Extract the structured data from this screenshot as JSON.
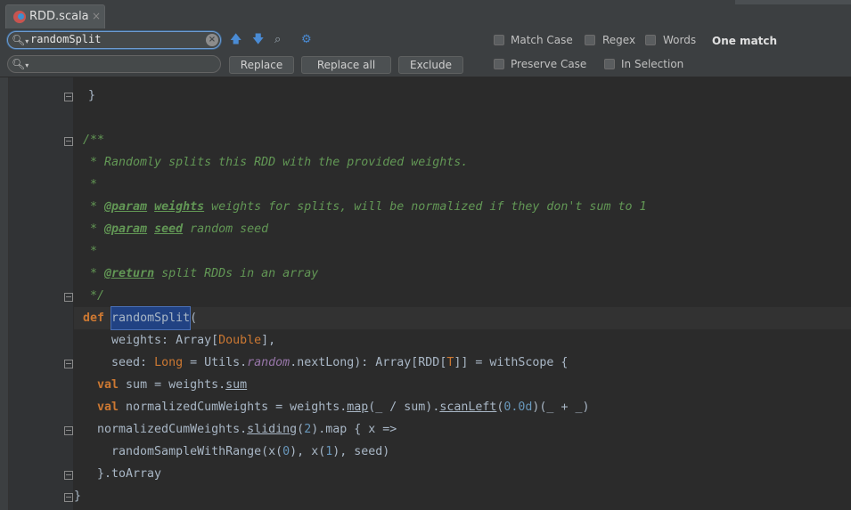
{
  "tab": {
    "label": "RDD.scala",
    "close": "×"
  },
  "find": {
    "query": "randomSplit",
    "replace_value": "",
    "buttons": {
      "replace": "Replace",
      "replace_all": "Replace all",
      "exclude": "Exclude"
    },
    "options": {
      "match_case": "Match Case",
      "regex": "Regex",
      "words": "Words",
      "preserve_case": "Preserve Case",
      "in_selection": "In Selection"
    },
    "result": "One match"
  },
  "code": {
    "l0": "  }",
    "l1": "/**",
    "l2": " * Randomly splits this RDD with the provided weights.",
    "l3": " *",
    "l4a": " * ",
    "l4b": "@param",
    "l4c": " ",
    "l4d": "weights",
    "l4e": " weights for splits, will be normalized if they don't sum to 1",
    "l5a": " * ",
    "l5b": "@param",
    "l5c": " ",
    "l5d": "seed",
    "l5e": " random seed",
    "l6": " *",
    "l7a": " * ",
    "l7b": "@return",
    "l7c": " split RDDs in an array",
    "l8": " */",
    "l9a": "def",
    "l9b": " ",
    "l9c": "randomSplit",
    "l9d": "(",
    "l10a": "    weights: Array[",
    "l10b": "Double",
    "l10c": "],",
    "l11a": "    seed: ",
    "l11b": "Long",
    "l11c": " = Utils.",
    "l11d": "random",
    "l11e": ".nextLong): Array[RDD[",
    "l11f": "T",
    "l11g": "]] = withScope {",
    "l12a": "  ",
    "l12b": "val",
    "l12c": " sum = weights.",
    "l12d": "sum",
    "l13a": "  ",
    "l13b": "val",
    "l13c": " normalizedCumWeights = weights.",
    "l13d": "map",
    "l13e": "(_ / sum).",
    "l13f": "scanLeft",
    "l13g": "(",
    "l13h": "0.0d",
    "l13i": ")(_ + _)",
    "l14a": "  normalizedCumWeights.",
    "l14b": "sliding",
    "l14c": "(",
    "l14d": "2",
    "l14e": ").map { x =>",
    "l15a": "    randomSampleWithRange(x(",
    "l15b": "0",
    "l15c": "), x(",
    "l15d": "1",
    "l15e": "), seed)",
    "l16": "  }.toArray",
    "l17": "}"
  },
  "colors": {
    "keyword": "#cc7832",
    "comment": "#629755",
    "number": "#6897bb",
    "field": "#9876aa",
    "text": "#a9b7c6",
    "selection": "#214283"
  }
}
